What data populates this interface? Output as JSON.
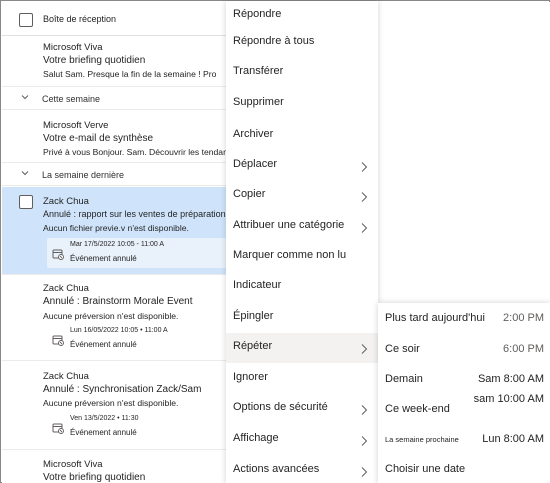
{
  "list": {
    "header": "Boîte de réception",
    "groups": [
      "Cette semaine",
      "La semaine dernière"
    ],
    "messages": [
      {
        "sender": "Microsoft Viva",
        "subject": "Votre briefing quotidien",
        "preview": "Salut Sam. Presque la fin de la semaine ! Pro"
      },
      {
        "sender": "Microsoft Verve",
        "subject": "Votre e-mail de synthèse",
        "preview": "Privé à vous Bonjour. Sam. Découvrir les tendances dans"
      },
      {
        "sender": "Zack Chua",
        "subject": "Annulé : rapport sur les ventes de préparation",
        "preview": "Aucun fichier previe.v n'est disponible.",
        "event_date": "Mar 17/5/2022 10:05 - 11:00 A",
        "event_status": "Événement annulé"
      },
      {
        "sender": "Zack Chua",
        "subject": "Annulé : Brainstorm Morale Event",
        "preview": "Aucune préversion n'est disponible.",
        "event_date": "Lun 16/05/2022 10:05 • 11:00 A",
        "event_status": "Événement annulé"
      },
      {
        "sender": "Zack Chua",
        "subject": "Annulé : Synchronisation Zack/Sam",
        "preview": "Aucune préversion n'est disponible.",
        "event_date": "Ven 13/5/2022 • 11:30",
        "event_status": "Événement annulé"
      },
      {
        "sender": "Microsoft Viva",
        "subject": "Votre briefing quotidien",
        "preview": ""
      }
    ]
  },
  "menu": {
    "items": [
      {
        "label": "Répondre",
        "submenu": false
      },
      {
        "label": "Répondre à tous",
        "submenu": false
      },
      {
        "label": "Transférer",
        "submenu": false
      },
      {
        "label": "Supprimer",
        "submenu": false
      },
      {
        "label": "Archiver",
        "submenu": false
      },
      {
        "label": "Déplacer",
        "submenu": true
      },
      {
        "label": "Copier",
        "submenu": true
      },
      {
        "label": "Attribuer une catégorie",
        "submenu": true
      },
      {
        "label": "Marquer comme non lu",
        "submenu": false
      },
      {
        "label": "Indicateur",
        "submenu": false
      },
      {
        "label": "Épingler",
        "submenu": false
      },
      {
        "label": "Répéter",
        "submenu": true
      },
      {
        "label": "Ignorer",
        "submenu": false
      },
      {
        "label": "Options de sécurité",
        "submenu": true
      },
      {
        "label": "Affichage",
        "submenu": true
      },
      {
        "label": "Actions avancées",
        "submenu": true
      }
    ]
  },
  "snooze": {
    "items": [
      {
        "label": "Plus tard aujourd'hui",
        "time": "2:00 PM"
      },
      {
        "label": "Ce soir",
        "time": "6:00 PM"
      },
      {
        "label": "Demain",
        "time": "Sam 8:00 AM"
      },
      {
        "label": "Ce week-end",
        "time": "sam 10:00 AM"
      },
      {
        "label": "La semaine prochaine",
        "time": "Lun 8:00 AM"
      },
      {
        "label": "Choisir une date",
        "time": ""
      }
    ]
  },
  "colors": {
    "selected": "#cfe4fa",
    "hover": "#f3f2f1"
  },
  "icons": [
    "chevron-down-icon",
    "chevron-right-icon",
    "calendar-cancel-icon",
    "checkbox-icon"
  ]
}
